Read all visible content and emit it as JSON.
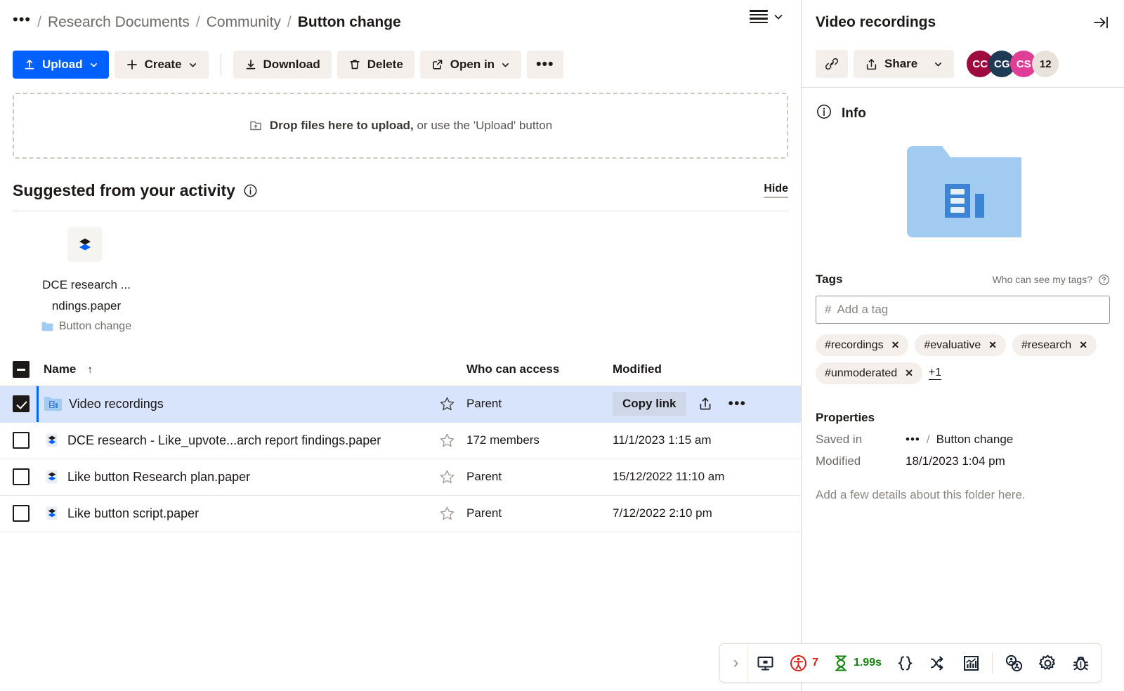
{
  "breadcrumb": {
    "overflow": "•••",
    "separator": "/",
    "items": [
      {
        "label": "Research Documents"
      },
      {
        "label": "Community"
      },
      {
        "label": "Button change"
      }
    ]
  },
  "toolbar": {
    "upload": "Upload",
    "create": "Create",
    "download": "Download",
    "delete": "Delete",
    "open_in": "Open in",
    "overflow": "•••",
    "primary_color": "#0061ff",
    "button_bg": "#f4efea"
  },
  "dropzone": {
    "strong": "Drop files here to upload,",
    "rest": " or use the 'Upload' button"
  },
  "suggested": {
    "title": "Suggested from your activity",
    "hide": "Hide",
    "cards": [
      {
        "name_line1": "DCE research ...",
        "name_line2": "ndings.paper",
        "location": "Button change",
        "icon": "paper-file-icon"
      }
    ]
  },
  "table": {
    "headers": {
      "name": "Name",
      "sort_arrow": "↑",
      "access": "Who can access",
      "modified": "Modified"
    },
    "row_actions": {
      "copy_link": "Copy link",
      "share": "share-icon",
      "more": "•••"
    },
    "rows": [
      {
        "name": "Video recordings",
        "icon": "folder-media-icon",
        "access": "Parent",
        "modified": "",
        "selected": true,
        "checked": true
      },
      {
        "name": "DCE research - Like_upvote...arch report findings.paper",
        "icon": "paper-file-icon",
        "access": "172 members",
        "modified": "11/1/2023 1:15 am",
        "selected": false,
        "checked": false
      },
      {
        "name": "Like button Research plan.paper",
        "icon": "paper-file-icon",
        "access": "Parent",
        "modified": "15/12/2022 11:10 am",
        "selected": false,
        "checked": false
      },
      {
        "name": "Like button script.paper",
        "icon": "paper-file-icon",
        "access": "Parent",
        "modified": "7/12/2022 2:10 pm",
        "selected": false,
        "checked": false
      }
    ]
  },
  "panel": {
    "title": "Video recordings",
    "collapse_icon": "collapse-right-icon",
    "link_icon": "link-icon",
    "share_label": "Share",
    "avatars": [
      {
        "initials": "CC",
        "color": "#9e0b3f"
      },
      {
        "initials": "CG",
        "color": "#1f3a55"
      },
      {
        "initials": "CS",
        "color": "#de3e96"
      },
      {
        "initials": "12",
        "color": "#e8e2da",
        "is_count": true
      }
    ],
    "info_label": "Info",
    "folder_icon": "folder-media-large-icon",
    "tags": {
      "title": "Tags",
      "who_can_see": "Who can see my tags?",
      "placeholder": "Add a tag",
      "hash": "#",
      "chips": [
        {
          "label": "#recordings"
        },
        {
          "label": "#evaluative"
        },
        {
          "label": "#research"
        },
        {
          "label": "#unmoderated"
        }
      ],
      "more": "+1"
    },
    "properties": {
      "title": "Properties",
      "saved_in_key": "Saved in",
      "saved_in_overflow": "•••",
      "saved_in_sep": "/",
      "saved_in_value": "Button change",
      "modified_key": "Modified",
      "modified_value": "18/1/2023 1:04 pm",
      "description_placeholder": "Add a few details about this folder here."
    }
  },
  "devbar": {
    "expand": "›",
    "items": [
      {
        "icon": "screen-icon",
        "label": ""
      },
      {
        "icon": "accessibility-icon",
        "label": "7",
        "color": "#d91e18"
      },
      {
        "icon": "hourglass-icon",
        "label": "1.99s",
        "color": "#13820c"
      },
      {
        "icon": "braces-icon",
        "label": ""
      },
      {
        "icon": "shuffle-icon",
        "label": ""
      },
      {
        "icon": "chart-icon",
        "label": ""
      },
      {
        "icon": "accounts-icon",
        "label": ""
      },
      {
        "icon": "gear-icon",
        "label": ""
      },
      {
        "icon": "bug-icon",
        "label": ""
      }
    ]
  }
}
